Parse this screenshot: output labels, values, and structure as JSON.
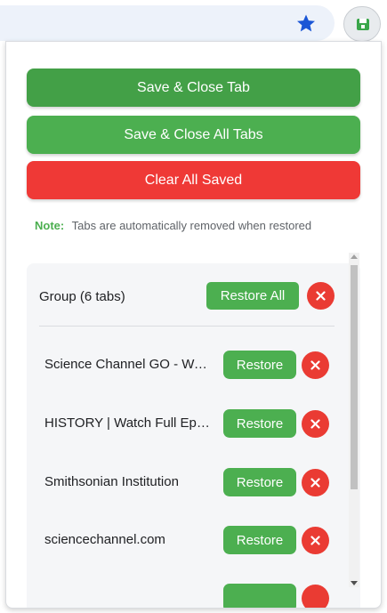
{
  "browser": {
    "star_icon": "star-icon",
    "extension_icon": "extension-save-icon",
    "accent_color": "#1a56d6"
  },
  "popup": {
    "buttons": {
      "save_close_tab": "Save & Close Tab",
      "save_close_all": "Save & Close All Tabs",
      "clear_all": "Clear All Saved"
    },
    "note": {
      "label": "Note:",
      "text": "Tabs are automatically removed when restored"
    },
    "group": {
      "title": "Group (6 tabs)",
      "restore_all_label": "Restore All",
      "tabs": [
        {
          "title": "Science Channel GO - Watch Full Episodes",
          "restore_label": "Restore"
        },
        {
          "title": "HISTORY | Watch Full Episodes",
          "restore_label": "Restore"
        },
        {
          "title": "Smithsonian Institution",
          "restore_label": "Restore"
        },
        {
          "title": "sciencechannel.com",
          "restore_label": "Restore"
        }
      ]
    },
    "colors": {
      "green": "#4caf50",
      "dark_green": "#43a047",
      "red": "#ef3936"
    }
  }
}
